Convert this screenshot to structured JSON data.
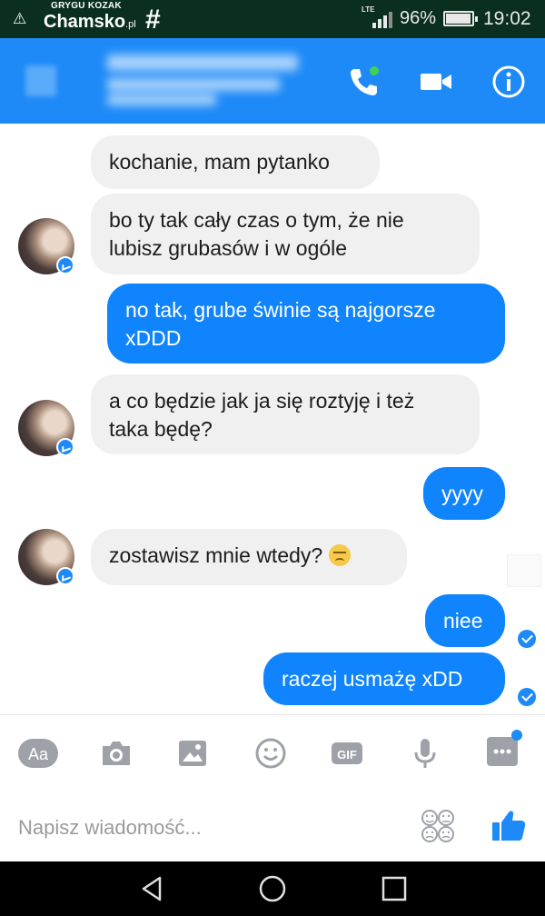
{
  "status_bar": {
    "watermark_top": "GRYGU KOZAK",
    "watermark_logo": "Chamsko",
    "watermark_tld": ".pl",
    "network": "LTE",
    "battery": "96%",
    "time": "19:02"
  },
  "header": {
    "icons": [
      "back-icon",
      "phone-call-icon",
      "video-camera-icon",
      "info-icon"
    ],
    "accent": "#1e8af7",
    "online_dot": "#42d152"
  },
  "messages": [
    {
      "side": "in",
      "text": "kochanie, mam pytanko"
    },
    {
      "side": "in",
      "text": "bo ty tak cały czas o tym, że nie\nlubisz grubasów i w ogóle"
    },
    {
      "side": "out",
      "text": "no tak, grube świnie są najgorsze\nxDDD"
    },
    {
      "side": "in",
      "text": "a co będzie jak ja się roztyję i też\ntaka będę?"
    },
    {
      "side": "out",
      "text": "yyyy"
    },
    {
      "side": "in",
      "text": "zostawisz mnie wtedy?",
      "emoji": "disappointed-face-icon"
    },
    {
      "side": "out",
      "text": "niee"
    },
    {
      "side": "out",
      "text": "raczej usmażę xDD"
    }
  ],
  "colors": {
    "incoming_bubble": "#f1f0f0",
    "outgoing_bubble": "#0f84fd"
  },
  "toolbar": {
    "text_button_label": "Aa",
    "gif_label": "GIF",
    "icons": [
      "text-format-icon",
      "camera-icon",
      "gallery-icon",
      "emoji-icon",
      "gif-icon",
      "microphone-icon",
      "more-icon"
    ]
  },
  "composer": {
    "placeholder": "Napisz wiadomość..."
  }
}
